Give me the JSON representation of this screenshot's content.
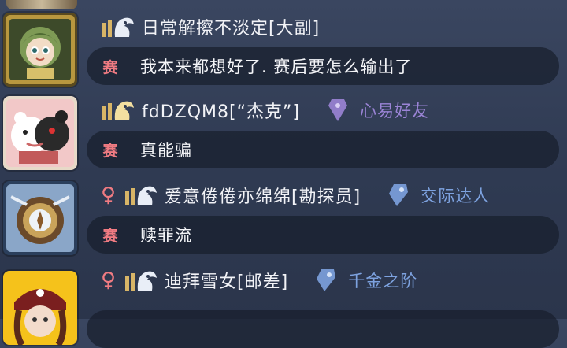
{
  "chat": {
    "messages": [
      {
        "gender_icon": "",
        "name": "日常解擦不淡定[大副]",
        "badge": null,
        "tag": "赛",
        "text": "我本来都想好了. 赛后要怎么输出了",
        "avatar": "green-haired-character-avatar-icon"
      },
      {
        "gender_icon": "",
        "name": "fdDZQM8[“杰克”]",
        "badge": {
          "label": "心易好友",
          "color": "#9b84d6",
          "icon": "purple-tag-icon"
        },
        "tag": "赛",
        "text": "真能骗",
        "avatar": "panda-bear-avatar-icon"
      },
      {
        "gender_icon": "♀",
        "name": "爱意倦倦亦绵绵[勘探员]",
        "badge": {
          "label": "交际达人",
          "color": "#7da2df",
          "icon": "blue-tag-icon"
        },
        "tag": "赛",
        "text": "赎罪流",
        "avatar": "compass-artifact-avatar-icon"
      },
      {
        "gender_icon": "♀",
        "name": "迪拜雪女[邮差]",
        "badge": {
          "label": "千金之阶",
          "color": "#7da2df",
          "icon": "blue-tag-icon"
        },
        "tag": "",
        "text": "",
        "avatar": "pirate-girl-avatar-icon"
      }
    ]
  },
  "colors": {
    "accent_pink": "#f07b82",
    "bubble_bg": "#181e2c",
    "gold": "#d8b567"
  }
}
